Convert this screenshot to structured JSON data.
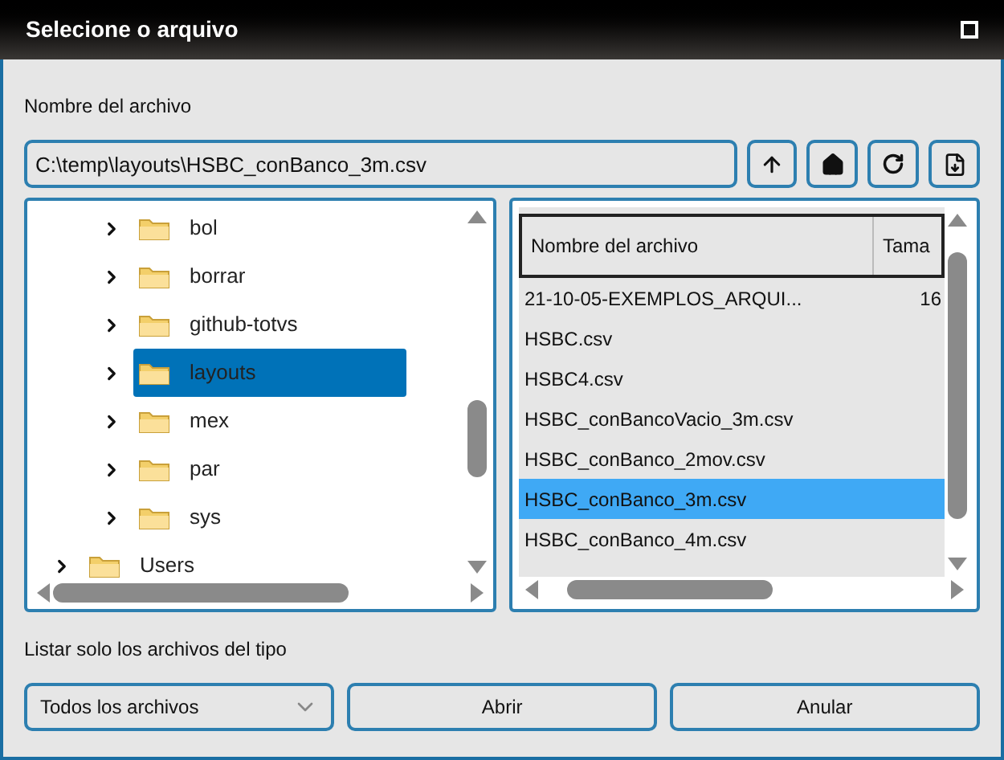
{
  "window": {
    "title": "Selecione o arquivo"
  },
  "file_name": {
    "label": "Nombre del archivo",
    "value": "C:\\temp\\layouts\\HSBC_conBanco_3m.csv"
  },
  "tree": [
    {
      "children": [
        {
          "label": "bol",
          "expanded": false,
          "selected": false
        },
        {
          "label": "borrar",
          "expanded": false,
          "selected": false
        },
        {
          "label": "github-totvs",
          "expanded": false,
          "selected": false
        },
        {
          "label": "layouts",
          "expanded": false,
          "selected": true
        },
        {
          "label": "mex",
          "expanded": false,
          "selected": false
        },
        {
          "label": "par",
          "expanded": false,
          "selected": false
        },
        {
          "label": "sys",
          "expanded": false,
          "selected": false
        }
      ]
    },
    {
      "label": "Users",
      "expanded": false,
      "selected": false
    }
  ],
  "files": {
    "columns": [
      "Nombre del archivo",
      "Tama"
    ],
    "rows": [
      {
        "name": "21-10-05-EXEMPLOS_ARQUI...",
        "size": "16",
        "selected": false
      },
      {
        "name": "HSBC.csv",
        "selected": false
      },
      {
        "name": "HSBC4.csv",
        "selected": false
      },
      {
        "name": "HSBC_conBancoVacio_3m.csv",
        "selected": false
      },
      {
        "name": "HSBC_conBanco_2mov.csv",
        "selected": false
      },
      {
        "name": "HSBC_conBanco_3m.csv",
        "selected": true
      },
      {
        "name": "HSBC_conBanco_4m.csv",
        "selected": false
      }
    ]
  },
  "filter": {
    "label": "Listar solo los archivos del tipo",
    "value": "Todos los archivos"
  },
  "buttons": [
    "Abrir",
    "Anular"
  ]
}
